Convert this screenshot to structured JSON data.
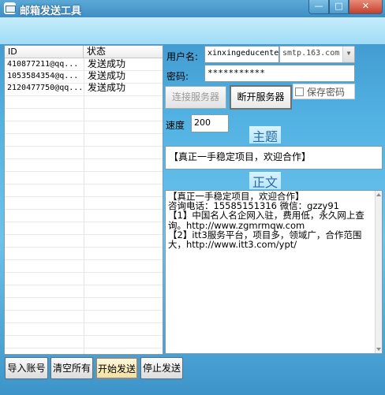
{
  "window": {
    "title": "邮箱发送工具",
    "min_glyph": "—",
    "max_glyph": "□",
    "close_glyph": "✕"
  },
  "account_list": {
    "columns": [
      "ID",
      "状态"
    ],
    "rows": [
      {
        "id": "410877211@qq...",
        "status": "发送成功"
      },
      {
        "id": "1053584354@q...",
        "status": "发送成功"
      },
      {
        "id": "2120477750@qq...",
        "status": "发送成功"
      }
    ]
  },
  "login": {
    "username_label": "用户名:",
    "username_value": "xinxingeducenter",
    "smtp_value": "smtp.163.com",
    "password_label": "密码:",
    "password_value": "***********",
    "connect_button": "连接服务器",
    "disconnect_button": "断开服务器",
    "save_password_label": "保存密码"
  },
  "speed": {
    "label": "速度",
    "value": "200"
  },
  "subject": {
    "header": "主题",
    "value": "【真正一手稳定项目，欢迎合作】"
  },
  "body": {
    "header": "正文",
    "lines": [
      "【真正一手稳定项目，欢迎合作】",
      "咨询电话：15585151316  微信：gzzy91",
      "【1】中国名人名企网入驻，费用低，永久网上查询。http://www.zgmrmqw.com",
      "【2】itt3服务平台，项目多，领域广，合作范围大，http://www.itt3.com/ypt/"
    ]
  },
  "actions": {
    "import": "导入账号",
    "clear": "清空所有",
    "start": "开始发送",
    "stop": "停止发送"
  },
  "colors": {
    "window_bg": "#52b2e2",
    "section_header_text": "#2a6aa8"
  }
}
